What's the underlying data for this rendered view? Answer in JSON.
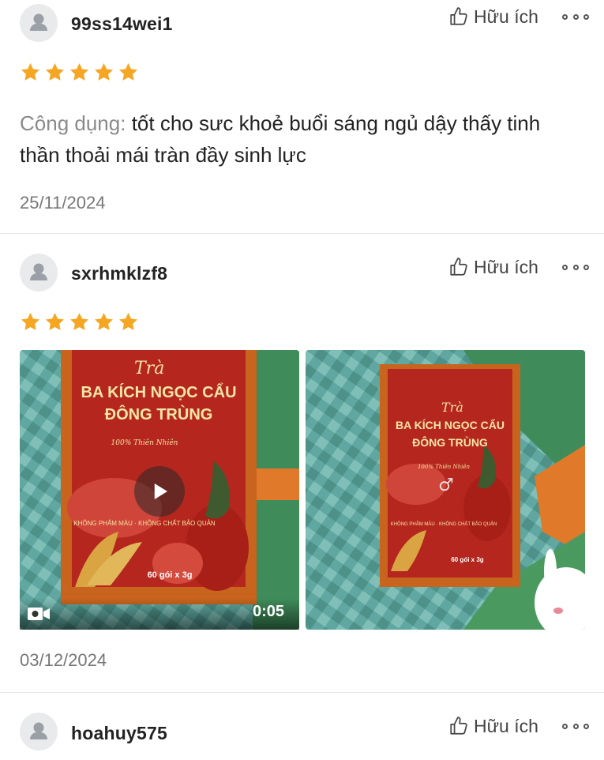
{
  "reviews": [
    {
      "username": "99ss14wei1",
      "rating": 5,
      "helpful_label": "Hữu ích",
      "attribute_label": "Công dụng:",
      "text": "tốt cho sưc khoẻ buổi sáng ngủ dậy thấy tinh thần thoải mái tràn đầy sinh lực",
      "date": "25/11/2024"
    },
    {
      "username": "sxrhmklzf8",
      "rating": 5,
      "helpful_label": "Hữu ích",
      "video_duration": "0:05",
      "product": {
        "title_script": "Trà",
        "title_line1": "BA KÍCH NGỌC CẨU",
        "title_line2": "ĐÔNG TRÙNG",
        "badge": "100% Thiên Nhiên",
        "claims": "KHÔNG PHẨM MÀU · KHÔNG CHẤT BẢO QUẢN",
        "pack": "60 gói x 3g"
      },
      "date": "03/12/2024"
    },
    {
      "username": "hoahuy575",
      "helpful_label": "Hữu ích"
    }
  ],
  "colors": {
    "star": "#f5a623",
    "box_orange": "#c8641e",
    "box_red": "#b5271e",
    "text_muted": "#8a8a8a"
  },
  "icons": {
    "avatar": "user-avatar-icon",
    "helpful": "thumbs-up-icon",
    "more": "more-options-icon",
    "star": "star-icon",
    "play": "play-icon",
    "video": "video-camera-icon"
  }
}
